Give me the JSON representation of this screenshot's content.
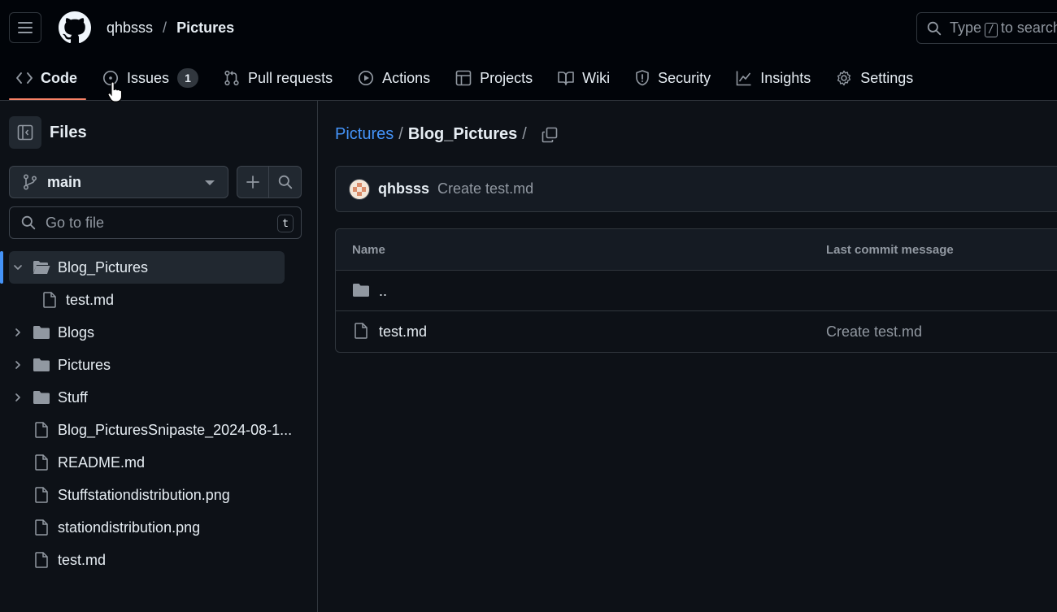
{
  "header": {
    "owner": "qhbsss",
    "separator": "/",
    "repo": "Pictures",
    "search_prefix": "Type",
    "search_key": "/",
    "search_suffix": "to search",
    "icons": {
      "menu": "hamburger-icon",
      "logo": "github-logo-icon",
      "search": "search-icon"
    }
  },
  "tabs": [
    {
      "label": "Code",
      "icon": "code-icon",
      "active": true
    },
    {
      "label": "Issues",
      "icon": "issue-opened-icon",
      "counter": "1"
    },
    {
      "label": "Pull requests",
      "icon": "git-pull-request-icon"
    },
    {
      "label": "Actions",
      "icon": "play-icon"
    },
    {
      "label": "Projects",
      "icon": "table-icon"
    },
    {
      "label": "Wiki",
      "icon": "book-icon"
    },
    {
      "label": "Security",
      "icon": "shield-icon"
    },
    {
      "label": "Insights",
      "icon": "graph-icon"
    },
    {
      "label": "Settings",
      "icon": "gear-icon"
    }
  ],
  "sidebar": {
    "title": "Files",
    "branch": "main",
    "goto_placeholder": "Go to file",
    "goto_key": "t",
    "tree": [
      {
        "label": "Blog_Pictures",
        "type": "folder-open",
        "expanded": true,
        "selected": true,
        "depth": 0
      },
      {
        "label": "test.md",
        "type": "file",
        "depth": 1
      },
      {
        "label": "Blogs",
        "type": "folder",
        "depth": 0
      },
      {
        "label": "Pictures",
        "type": "folder",
        "depth": 0
      },
      {
        "label": "Stuff",
        "type": "folder",
        "depth": 0
      },
      {
        "label": "Blog_PicturesSnipaste_2024-08-1...",
        "type": "file",
        "depth": 0
      },
      {
        "label": "README.md",
        "type": "file",
        "depth": 0
      },
      {
        "label": "Stuffstationdistribution.png",
        "type": "file",
        "depth": 0
      },
      {
        "label": "stationdistribution.png",
        "type": "file",
        "depth": 0
      },
      {
        "label": "test.md",
        "type": "file",
        "depth": 0
      }
    ]
  },
  "main": {
    "path": {
      "root": "Pictures",
      "sep": "/",
      "current": "Blog_Pictures",
      "trail": "/"
    },
    "commit": {
      "author": "qhbsss",
      "message": "Create test.md"
    },
    "table": {
      "headers": {
        "name": "Name",
        "message": "Last commit message"
      },
      "rows": [
        {
          "name": "..",
          "type": "folder",
          "message": ""
        },
        {
          "name": "test.md",
          "type": "file",
          "message": "Create test.md"
        }
      ]
    }
  },
  "colors": {
    "accent": "#4493f8",
    "active_tab_underline": "#f78166",
    "bg": "#0d1117",
    "header_bg": "#010409"
  }
}
